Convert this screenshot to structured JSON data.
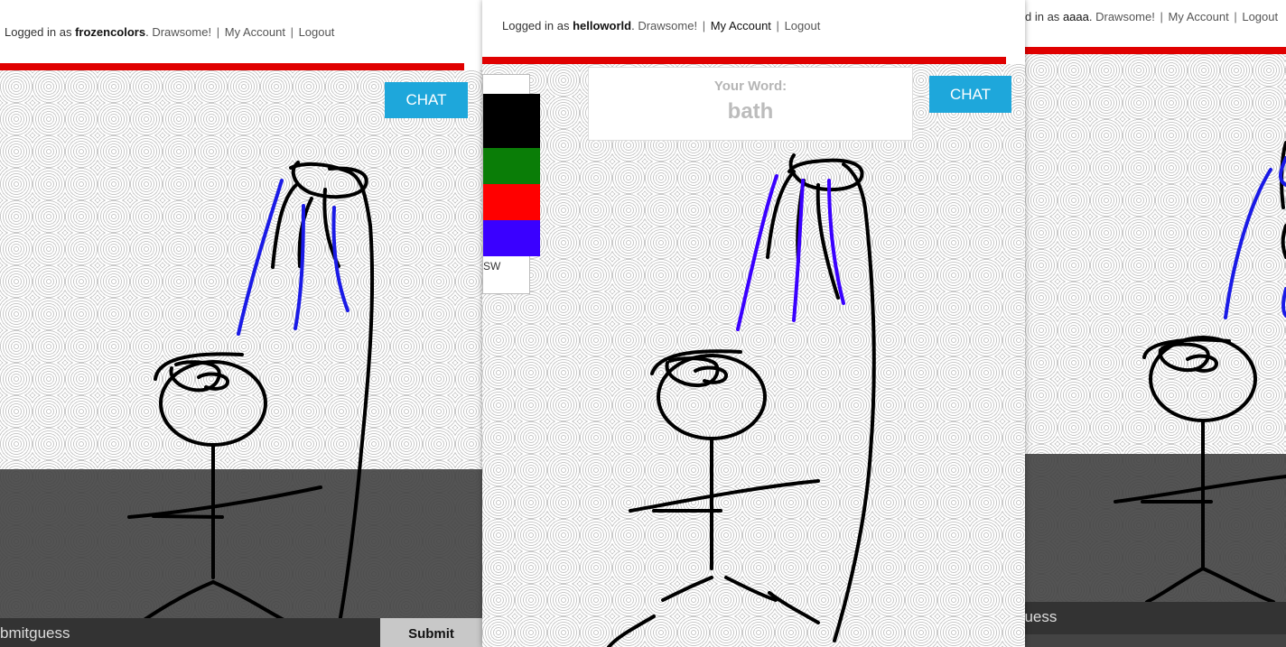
{
  "left_window": {
    "header": {
      "prefix": "Logged in as",
      "username": "frozencolors",
      "brand": "Drawsome!",
      "my_account": "My Account",
      "logout": "Logout",
      "separator": "|",
      "period": "."
    },
    "chat_label": "CHAT",
    "guess_placeholder": "Submitguess",
    "guess_value": "bmitguess",
    "submit_label": "Submit"
  },
  "middle_window": {
    "header": {
      "prefix": "Logged in as",
      "username": "helloworld",
      "brand": "Drawsome!",
      "my_account": "My Account",
      "logout": "Logout",
      "separator": "|",
      "period": "."
    },
    "chat_label": "CHAT",
    "word_label": "Your Word:",
    "word_value": "bath",
    "palette": {
      "colors": [
        "#000000",
        "#0a7d07",
        "#ff0000",
        "#3a00ff"
      ],
      "swatch_names": [
        "black",
        "green",
        "red",
        "blue"
      ],
      "partial_label": "SW"
    }
  },
  "right_window": {
    "header": {
      "visible_prefix": "d in as",
      "username": "aaaa",
      "brand": "Drawsome!",
      "my_account": "My Account",
      "logout": "Logout",
      "separator": "|",
      "period": "."
    },
    "guess_value": "guess"
  },
  "colors": {
    "accent_red": "#e00000",
    "chat_blue": "#1ea7db",
    "stroke_black": "#000000",
    "stroke_blue": "#1a1ae6"
  }
}
